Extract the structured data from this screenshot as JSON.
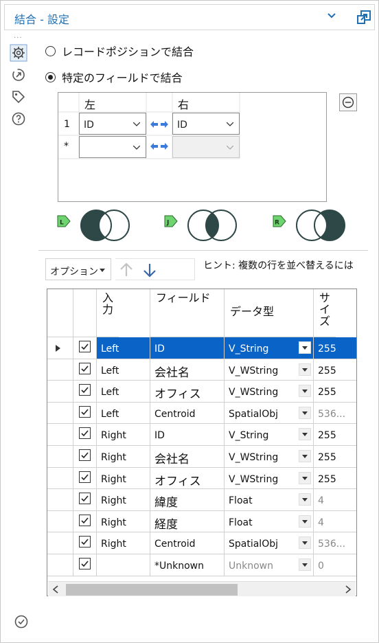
{
  "header": {
    "title": "結合 - 設定"
  },
  "options": {
    "radio_position": "レコードポジションで結合",
    "radio_field": "特定のフィールドで結合"
  },
  "join_table": {
    "left_header": "左",
    "right_header": "右",
    "rows": [
      {
        "num": "1",
        "left": "ID",
        "right": "ID"
      },
      {
        "num": "*",
        "left": "",
        "right": ""
      }
    ]
  },
  "toolbar": {
    "options_label": "オプション",
    "hint": "ヒント: 複数の行を並べ替えるには"
  },
  "grid": {
    "headers": [
      "入力",
      "フィールド",
      "データ型",
      "サイズ"
    ],
    "rows": [
      {
        "input": "Left",
        "field": "ID",
        "type": "V_String",
        "size": "255"
      },
      {
        "input": "Left",
        "field": "会社名",
        "type": "V_WString",
        "size": "255"
      },
      {
        "input": "Left",
        "field": "オフィス",
        "type": "V_WString",
        "size": "255"
      },
      {
        "input": "Left",
        "field": "Centroid",
        "type": "SpatialObj",
        "size": "536..."
      },
      {
        "input": "Right",
        "field": "ID",
        "type": "V_String",
        "size": "255"
      },
      {
        "input": "Right",
        "field": "会社名",
        "type": "V_WString",
        "size": "255"
      },
      {
        "input": "Right",
        "field": "オフィス",
        "type": "V_WString",
        "size": "255"
      },
      {
        "input": "Right",
        "field": "緯度",
        "type": "Float",
        "size": "4"
      },
      {
        "input": "Right",
        "field": "経度",
        "type": "Float",
        "size": "4"
      },
      {
        "input": "Right",
        "field": "Centroid",
        "type": "SpatialObj",
        "size": "536..."
      },
      {
        "input": "",
        "field": "*Unknown",
        "type": "Unknown",
        "size": "0"
      }
    ]
  },
  "colors": {
    "accent": "#1f6fb5",
    "selected_row": "#0a64c8",
    "venn_fill": "#2e4747",
    "badge": "#6fd36f"
  }
}
